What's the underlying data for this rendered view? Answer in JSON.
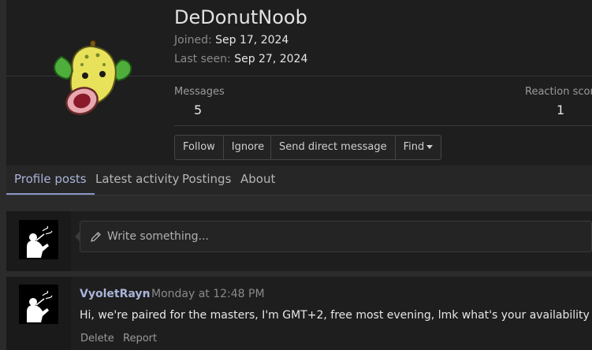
{
  "profile": {
    "username": "DeDonutNoob",
    "joined_label": "Joined:",
    "joined_value": "Sep 17, 2024",
    "last_seen_label": "Last seen:",
    "last_seen_value": "Sep 27, 2024",
    "avatar_icon": "weepinbell-avatar-icon",
    "stats": {
      "messages_label": "Messages",
      "messages_value": "5",
      "reaction_label": "Reaction score",
      "reaction_value": "1"
    },
    "buttons": {
      "follow": "Follow",
      "ignore": "Ignore",
      "send_dm": "Send direct message",
      "find": "Find"
    }
  },
  "tabs": [
    {
      "label": "Profile posts",
      "active": true
    },
    {
      "label": "Latest activity",
      "active": false
    },
    {
      "label": "Postings",
      "active": false
    },
    {
      "label": "About",
      "active": false
    }
  ],
  "composer": {
    "placeholder": "Write something...",
    "icon": "pencil-icon"
  },
  "posts": [
    {
      "author": "VyoletRayn",
      "separator": "·",
      "time": "Monday at 12:48 PM",
      "body": "Hi, we're paired for the masters, I'm GMT+2, free most evening, lmk what's your availability",
      "actions": {
        "delete": "Delete",
        "report": "Report"
      }
    }
  ],
  "colors": {
    "accent": "#8a95c4",
    "link": "#a9b3d8",
    "background": "#2b2b2b",
    "panel": "#1e1e1e"
  }
}
